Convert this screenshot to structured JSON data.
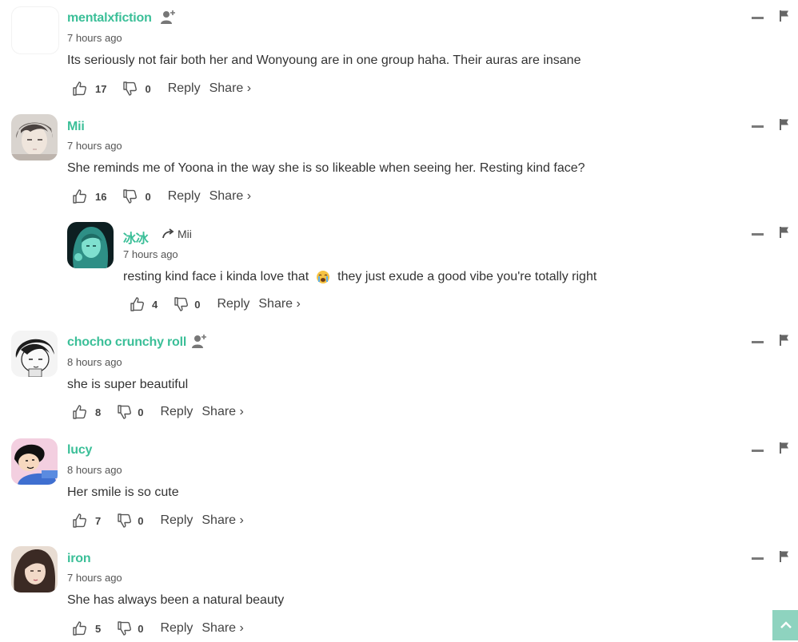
{
  "comments": [
    {
      "username": "mentalxfiction",
      "time": "7 hours ago",
      "text": "Its seriously not fair both her and Wonyoung are in one group haha. Their auras are insane",
      "likes": "17",
      "dislikes": "0",
      "reply_label": "Reply",
      "share_label": "Share ›",
      "avatar": "blank"
    },
    {
      "username": "Mii",
      "time": "7 hours ago",
      "text": "She reminds me of Yoona in the way she is so likeable when seeing her. Resting kind face?",
      "likes": "16",
      "dislikes": "0",
      "reply_label": "Reply",
      "share_label": "Share ›",
      "avatar": "manhwa-boy"
    },
    {
      "username": "冰冰",
      "reply_to": "Mii",
      "time": "7 hours ago",
      "text_before_emoji": "resting kind face i kinda love that",
      "text_emoji_name": "crying-face-emoji",
      "text_after_emoji": "they just exude a good vibe you're totally right",
      "likes": "4",
      "dislikes": "0",
      "reply_label": "Reply",
      "share_label": "Share ›",
      "avatar": "teal-girl"
    },
    {
      "username": "chocho crunchy roll",
      "time": "8 hours ago",
      "text": "she is super beautiful",
      "likes": "8",
      "dislikes": "0",
      "reply_label": "Reply",
      "share_label": "Share ›",
      "avatar": "bw-cartoon"
    },
    {
      "username": "lucy",
      "time": "8 hours ago",
      "text": "Her smile is so cute",
      "likes": "7",
      "dislikes": "0",
      "reply_label": "Reply",
      "share_label": "Share ›",
      "avatar": "lucy-cartoon"
    },
    {
      "username": "iron",
      "time": "7 hours ago",
      "text": "She has always been a natural beauty",
      "likes": "5",
      "dislikes": "0",
      "reply_label": "Reply",
      "share_label": "Share ›",
      "avatar": "photo-girl"
    }
  ],
  "colors": {
    "username": "#3bbf98",
    "scroll_top_bg": "#8ed3bf"
  },
  "icons": [
    "follow-user-icon",
    "thumbs-up-icon",
    "thumbs-down-icon",
    "reply-arrow-icon",
    "collapse-icon",
    "flag-icon",
    "arrow-up-icon"
  ]
}
